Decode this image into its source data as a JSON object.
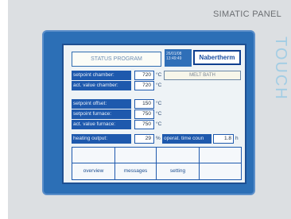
{
  "panel": {
    "brand": "SIMATIC PANEL",
    "touch_label": "TOUCH"
  },
  "screen": {
    "status_title": "STATUS PROGRAM",
    "date": "26/01/08",
    "time": "13:49:49",
    "logo_text": "Nabertherm",
    "mode_label": "MELT BATH",
    "rows": [
      {
        "label": "setpoint chamber:",
        "value": "720",
        "unit": "°C"
      },
      {
        "label": "act. value chamber:",
        "value": "720",
        "unit": "°C"
      },
      {
        "label": "setpoint offset:",
        "value": "150",
        "unit": "°C"
      },
      {
        "label": "setpoint furnace:",
        "value": "750",
        "unit": "°C"
      },
      {
        "label": "act. value furnace:",
        "value": "750",
        "unit": "°C"
      },
      {
        "label": "heating output:",
        "value": "29",
        "unit": "%"
      }
    ],
    "operat_time": {
      "label": "operat. time coun",
      "value": "1.8",
      "unit": "h"
    },
    "buttons": {
      "overview": "overview",
      "messages": "messages",
      "setting": "setting"
    }
  }
}
